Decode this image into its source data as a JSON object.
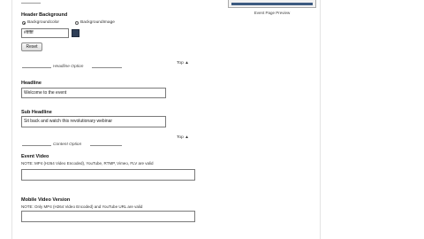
{
  "preview": {
    "caption": "Event Page Preview"
  },
  "header_background": {
    "title": "Header Background",
    "options": [
      "Backgroundcolor",
      "BackgroundImage"
    ],
    "selected_option": "Backgroundcolor",
    "color_value": "#ffffff",
    "swatch_color": "#2e3e57",
    "reset_label": "Reset"
  },
  "headline_section": {
    "divider_label": "Headline Option",
    "top_link": "Top ▲",
    "headline_label": "Headline",
    "headline_value": "Welcome to the event",
    "subheadline_label": "Sub Headline",
    "subheadline_value": "Sit back and watch this revolutionary webinar"
  },
  "content_section": {
    "divider_label": "Content Option",
    "top_link": "Top ▲",
    "event_video_label": "Event Video",
    "event_video_note": "NOTE: MP4 (H264 Video Encoded), YouTube, RTMP, Vimeo, FLV are valid",
    "event_video_value": "",
    "mobile_video_label": "Mobile Video Version",
    "mobile_video_note": "NOTE: Only MP4 (H264 Video Encoded) and YouTube URL are valid",
    "mobile_video_value": ""
  }
}
